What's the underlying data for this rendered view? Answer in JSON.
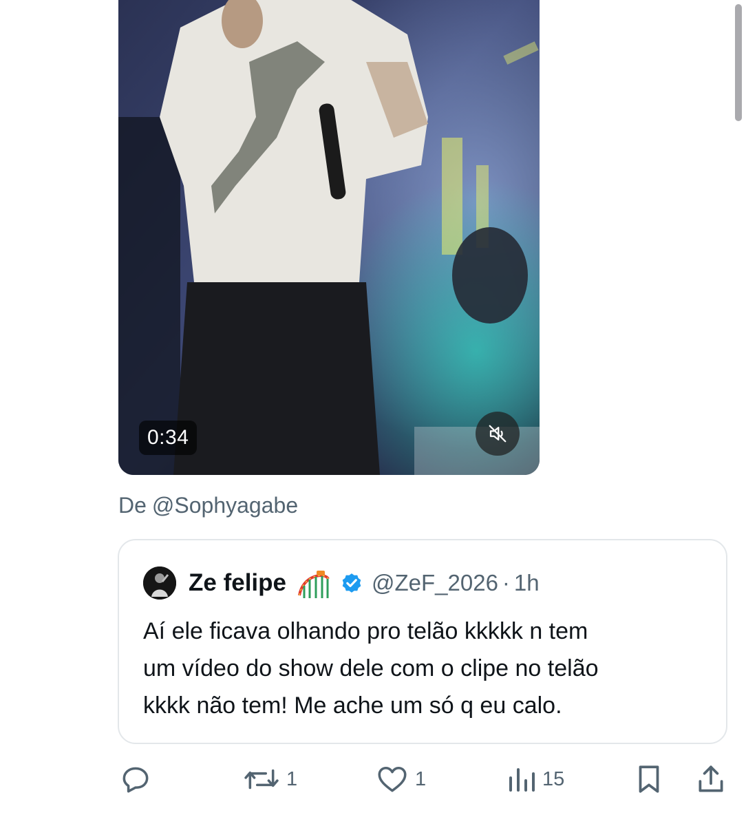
{
  "video": {
    "duration": "0:34",
    "mute_icon": "muted-speaker-icon"
  },
  "attribution": {
    "prefix": "De",
    "handle": "@Sophyagabe"
  },
  "quoted_post": {
    "display_name": "Ze felipe",
    "name_emoji": "roller-coaster-emoji",
    "verified": true,
    "verified_color": "#1d9bf0",
    "handle": "@ZeF_2026",
    "separator": "·",
    "age": "1h",
    "text_lines": [
      "Aí ele ficava olhando pro telão kkkkk n tem",
      "um vídeo do show dele com o clipe no telão",
      "kkkk não tem! Me ache um só q eu calo."
    ]
  },
  "actions": {
    "reply": {
      "icon": "reply-icon",
      "count": ""
    },
    "repost": {
      "icon": "repost-icon",
      "count": "1"
    },
    "like": {
      "icon": "heart-icon",
      "count": "1"
    },
    "views": {
      "icon": "views-chart-icon",
      "count": "15"
    },
    "bookmark": {
      "icon": "bookmark-icon"
    },
    "share": {
      "icon": "share-icon"
    }
  },
  "colors": {
    "text_primary": "#0f1419",
    "text_secondary": "#536471",
    "card_border": "#e3e7ea"
  }
}
